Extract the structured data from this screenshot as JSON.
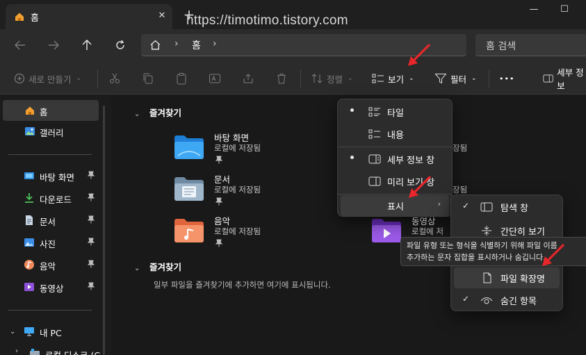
{
  "window": {
    "tab_title": "홈",
    "tab_close_symbol": "✕",
    "new_tab_symbol": "+",
    "watermark": "https://timotimo.tistory.com",
    "minimize_symbol": "—",
    "maximize_symbol": "☐"
  },
  "address": {
    "path": "홈",
    "chevron": "›",
    "search_placeholder": "홈 검색"
  },
  "toolbar": {
    "new_label": "새로 만들기",
    "sort_label": "정렬",
    "view_label": "보기",
    "filter_label": "필터",
    "more_label": "•••",
    "details_label": "세부 정보",
    "dropdown_chevron": "⌄"
  },
  "sidebar": {
    "items": [
      {
        "label": "홈",
        "icon": "home-icon"
      },
      {
        "label": "갤러리",
        "icon": "gallery-icon"
      },
      {
        "label": "바탕 화면",
        "icon": "desktop-icon"
      },
      {
        "label": "다운로드",
        "icon": "download-icon"
      },
      {
        "label": "문서",
        "icon": "document-icon"
      },
      {
        "label": "사진",
        "icon": "pictures-icon"
      },
      {
        "label": "음악",
        "icon": "music-icon"
      },
      {
        "label": "동영상",
        "icon": "videos-icon"
      },
      {
        "label": "내 PC",
        "icon": "pc-icon"
      },
      {
        "label": "로컬 디스크 (C",
        "icon": "drive-icon"
      }
    ],
    "pin_symbol": "📌"
  },
  "main": {
    "quick_access_header": "즐겨찾기",
    "favorites_header": "즐겨찾기",
    "favorites_empty": "일부 파일을 즐겨찾기에 추가하면 여기에 표시됩니다.",
    "folders": [
      {
        "name": "바탕 화면",
        "sub": "로컬에 저장됨"
      },
      {
        "name": "문서",
        "sub": "로컬에 저장됨"
      },
      {
        "name": "음악",
        "sub": "로컬에 저장됨"
      },
      {
        "name": "동영상",
        "sub": "로컬에 저"
      }
    ],
    "hidden_fragments": [
      "장됨",
      "장됨"
    ]
  },
  "view_menu": {
    "items": [
      {
        "label": "타일",
        "marker": "bullet"
      },
      {
        "label": "내용",
        "marker": ""
      },
      {
        "label": "세부 정보 창",
        "marker": "bullet"
      },
      {
        "label": "미리 보기 창",
        "marker": ""
      },
      {
        "label": "표시",
        "marker": "",
        "submenu": "›"
      }
    ]
  },
  "show_submenu": {
    "items": [
      {
        "label": "탐색 창",
        "checked": "✓"
      },
      {
        "label": "간단히 보기",
        "checked": ""
      },
      {
        "label": "파일 확장명",
        "checked": ""
      },
      {
        "label": "숨긴 항목",
        "checked": "✓"
      }
    ]
  },
  "tooltip": {
    "line1": "파일 유형 또는 형식을 식별하기 위해 파일 이름",
    "line2": "추가하는 문자 집합을 표시하거나 숨깁니다."
  },
  "colors": {
    "accent": "#4cc2ff",
    "annotation_arrow": "#e8262b",
    "folder_blue": "#2f8fe0",
    "folder_gray": "#8aa0b4"
  }
}
